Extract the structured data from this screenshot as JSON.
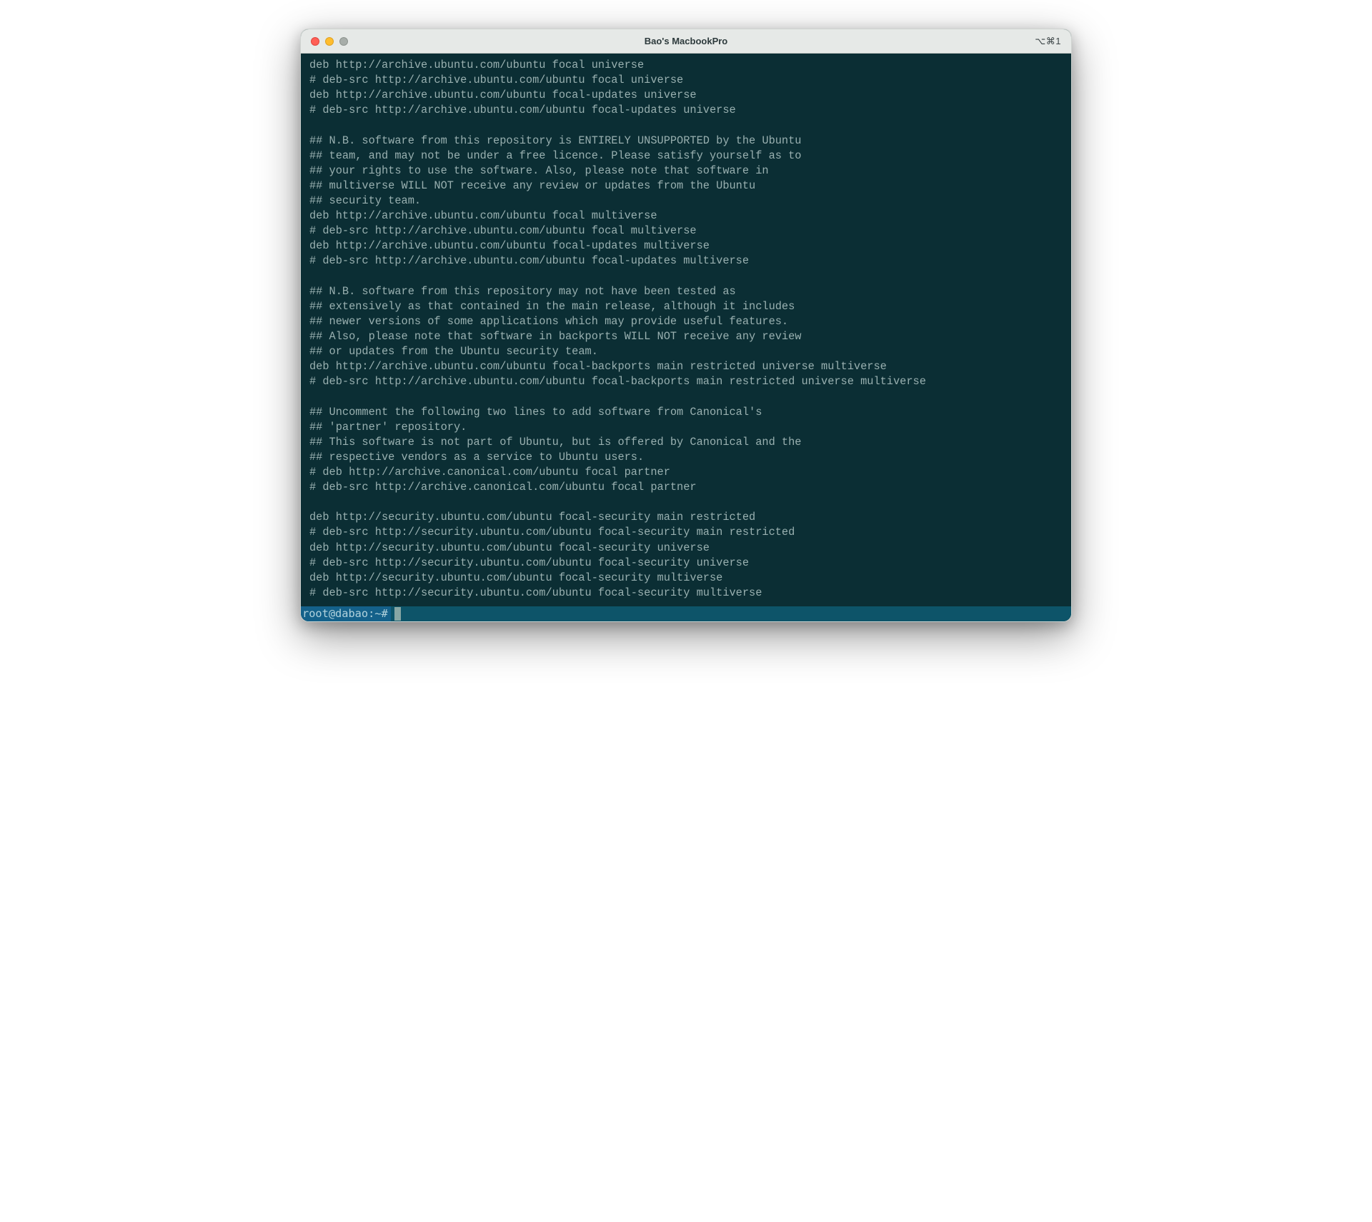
{
  "window": {
    "title": "Bao's MacbookPro",
    "shortcut_indicator": "⌥⌘1"
  },
  "terminal": {
    "lines": [
      "deb http://archive.ubuntu.com/ubuntu focal universe",
      "# deb-src http://archive.ubuntu.com/ubuntu focal universe",
      "deb http://archive.ubuntu.com/ubuntu focal-updates universe",
      "# deb-src http://archive.ubuntu.com/ubuntu focal-updates universe",
      "",
      "## N.B. software from this repository is ENTIRELY UNSUPPORTED by the Ubuntu",
      "## team, and may not be under a free licence. Please satisfy yourself as to",
      "## your rights to use the software. Also, please note that software in",
      "## multiverse WILL NOT receive any review or updates from the Ubuntu",
      "## security team.",
      "deb http://archive.ubuntu.com/ubuntu focal multiverse",
      "# deb-src http://archive.ubuntu.com/ubuntu focal multiverse",
      "deb http://archive.ubuntu.com/ubuntu focal-updates multiverse",
      "# deb-src http://archive.ubuntu.com/ubuntu focal-updates multiverse",
      "",
      "## N.B. software from this repository may not have been tested as",
      "## extensively as that contained in the main release, although it includes",
      "## newer versions of some applications which may provide useful features.",
      "## Also, please note that software in backports WILL NOT receive any review",
      "## or updates from the Ubuntu security team.",
      "deb http://archive.ubuntu.com/ubuntu focal-backports main restricted universe multiverse",
      "# deb-src http://archive.ubuntu.com/ubuntu focal-backports main restricted universe multiverse",
      "",
      "## Uncomment the following two lines to add software from Canonical's",
      "## 'partner' repository.",
      "## This software is not part of Ubuntu, but is offered by Canonical and the",
      "## respective vendors as a service to Ubuntu users.",
      "# deb http://archive.canonical.com/ubuntu focal partner",
      "# deb-src http://archive.canonical.com/ubuntu focal partner",
      "",
      "deb http://security.ubuntu.com/ubuntu focal-security main restricted",
      "# deb-src http://security.ubuntu.com/ubuntu focal-security main restricted",
      "deb http://security.ubuntu.com/ubuntu focal-security universe",
      "# deb-src http://security.ubuntu.com/ubuntu focal-security universe",
      "deb http://security.ubuntu.com/ubuntu focal-security multiverse",
      "# deb-src http://security.ubuntu.com/ubuntu focal-security multiverse"
    ],
    "prompt": "root@dabao:~#"
  }
}
